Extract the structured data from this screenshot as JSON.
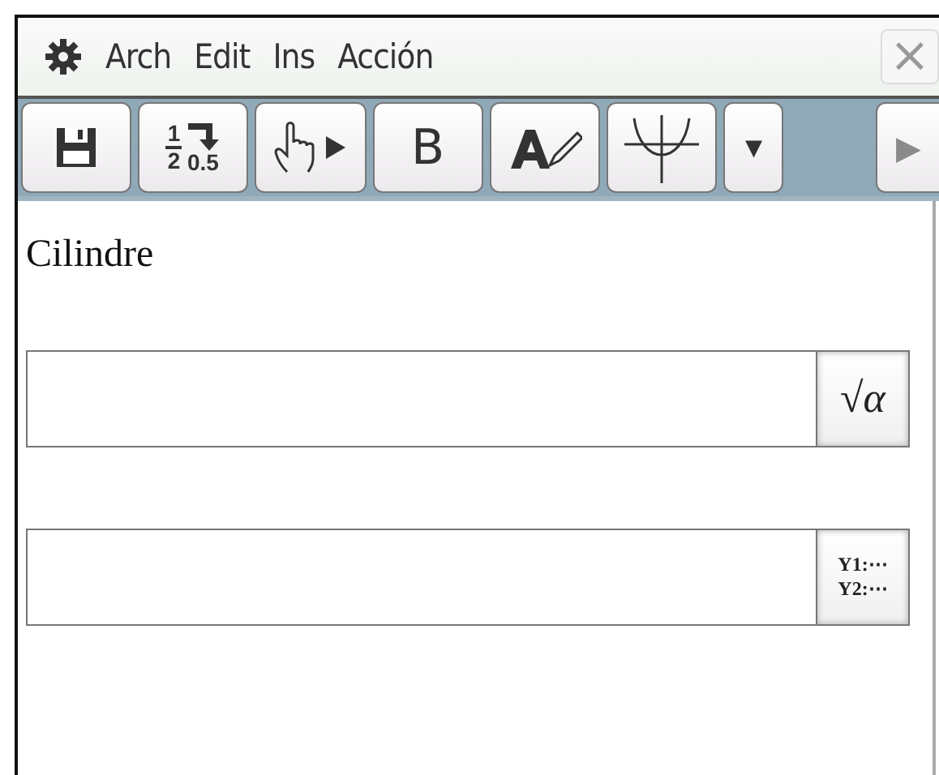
{
  "menu_bar": {
    "items": [
      "Arch",
      "Edit",
      "Ins",
      "Acción"
    ],
    "close": {
      "label": "×",
      "disabled": true
    }
  },
  "toolbar": {
    "buttons": [
      {
        "kind": "save"
      },
      {
        "kind": "fraction",
        "numerator": "1",
        "denominator": "2",
        "result": "0.5"
      },
      {
        "kind": "hand"
      },
      {
        "kind": "text",
        "label": "B"
      },
      {
        "kind": "format"
      },
      {
        "kind": "graph"
      },
      {
        "kind": "dropdown",
        "label": "▼"
      }
    ],
    "scroll": {
      "label": "▶",
      "disabled": true
    }
  },
  "document": {
    "title": "Cilindre",
    "fields": [
      {
        "kind": "math",
        "button": "√α"
      },
      {
        "kind": "graph",
        "button_lines": [
          "Y1:⋯",
          "Y2:⋯"
        ]
      }
    ]
  }
}
